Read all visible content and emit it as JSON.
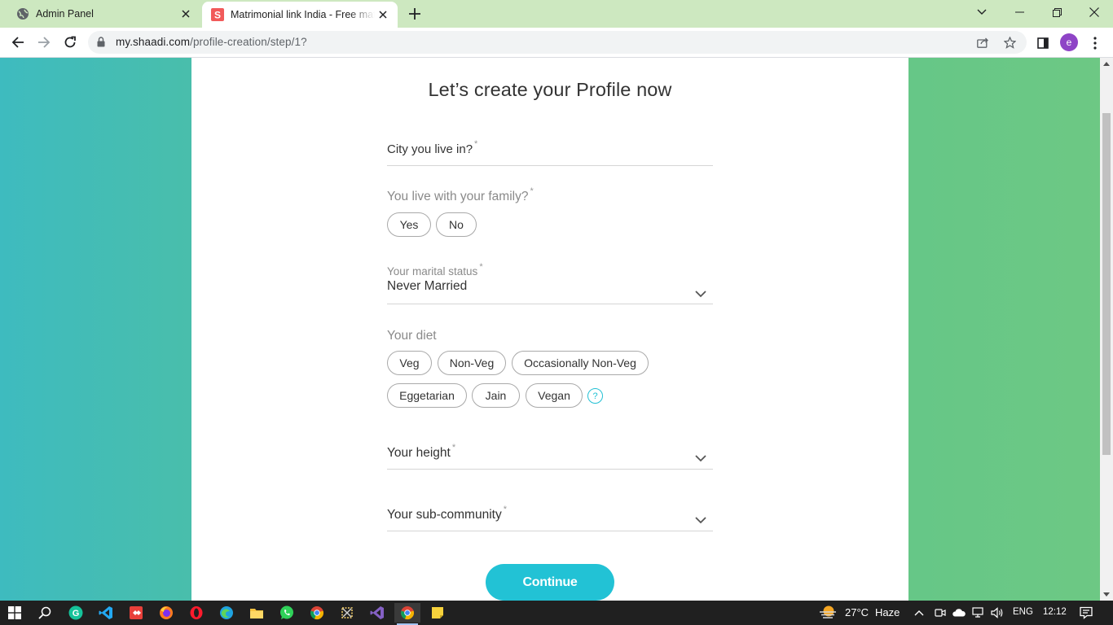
{
  "browser": {
    "tabs": [
      {
        "title": "Admin Panel",
        "active": false
      },
      {
        "title": "Matrimonial link India - Free matrimonial",
        "active": true
      }
    ],
    "url": {
      "host": "my.shaadi.com",
      "path": "/profile-creation/step/1?"
    },
    "profile_initial": "e"
  },
  "page": {
    "heading": "Let’s create your Profile now",
    "required_mark": "*",
    "city": {
      "label": "City you live in?"
    },
    "family": {
      "label": "You live with your family?",
      "options": [
        "Yes",
        "No"
      ]
    },
    "marital": {
      "label": "Your marital status",
      "value": "Never Married"
    },
    "diet": {
      "label": "Your diet",
      "options": [
        "Veg",
        "Non-Veg",
        "Occasionally Non-Veg",
        "Eggetarian",
        "Jain",
        "Vegan"
      ],
      "help": "?"
    },
    "height": {
      "label": "Your height"
    },
    "subcommunity": {
      "label": "Your sub-community"
    },
    "continue_label": "Continue"
  },
  "taskbar": {
    "weather": {
      "temp": "27°C",
      "condition": "Haze"
    },
    "language": "ENG",
    "time": "12:12"
  },
  "colors": {
    "accent": "#22c2d5",
    "tab_strip": "#cde8c0"
  }
}
